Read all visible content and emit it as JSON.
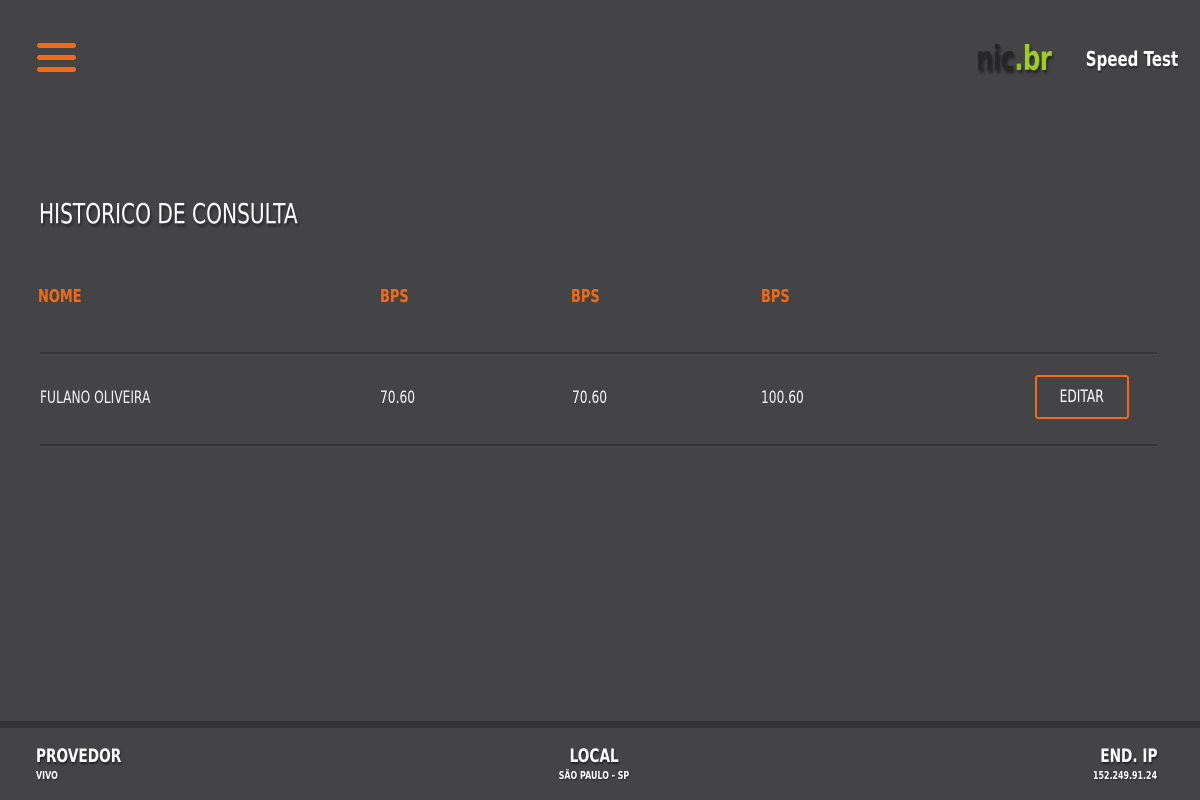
{
  "header": {
    "logo": {
      "nic": "nic",
      "dot": ".",
      "br": "br"
    },
    "app_name": "Speed Test",
    "menu_icon": "hamburger-menu-icon"
  },
  "page": {
    "title": "HISTORICO DE CONSULTA"
  },
  "table": {
    "columns": [
      "NOME",
      "BPS",
      "BPS",
      "BPS"
    ],
    "rows": [
      {
        "name": "FULANO OLIVEIRA",
        "bps_1": "70.60",
        "bps_2": "70.60",
        "bps_3": "100.60",
        "action_label": "EDITAR"
      }
    ]
  },
  "footer": {
    "provider": {
      "label": "PROVEDOR",
      "value": "VIVO"
    },
    "location": {
      "label": "LOCAL",
      "value": "SÃO PAULO - SP"
    },
    "ip": {
      "label": "END. IP",
      "value": "152.249.91.24"
    }
  },
  "colors": {
    "background": "#444446",
    "accent": "#f26a16",
    "logo_green": "#9fcc24",
    "logo_dark": "#262626",
    "divider": "#343436"
  }
}
